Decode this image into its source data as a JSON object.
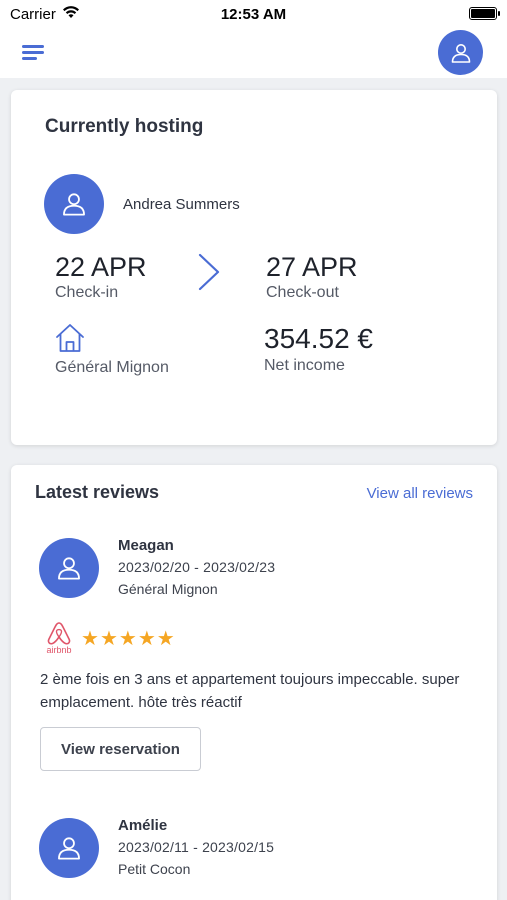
{
  "status_bar": {
    "carrier": "Carrier",
    "time": "12:53 AM"
  },
  "header": {
    "menu_icon": "menu-icon",
    "profile_icon": "user-icon"
  },
  "hosting": {
    "title": "Currently hosting",
    "guest_name": "Andrea Summers",
    "checkin_date": "22 APR",
    "checkin_label": "Check-in",
    "checkout_date": "27 APR",
    "checkout_label": "Check-out",
    "property_name": "Général Mignon",
    "net_income": "354.52 €",
    "net_income_label": "Net income"
  },
  "reviews": {
    "title": "Latest reviews",
    "view_all_label": "View all reviews",
    "items": [
      {
        "name": "Meagan",
        "dates": "2023/02/20 - 2023/02/23",
        "property": "Général Mignon",
        "source": "airbnb",
        "rating": 5,
        "text": "2 ème fois en 3 ans et appartement toujours impeccable. super emplacement. hôte très réactif",
        "button_label": "View reservation"
      },
      {
        "name": "Amélie",
        "dates": "2023/02/11 - 2023/02/15",
        "property": "Petit Cocon"
      }
    ]
  },
  "colors": {
    "accent": "#4a6cd4",
    "star": "#f5a623",
    "airbnb": "#e0566a"
  }
}
